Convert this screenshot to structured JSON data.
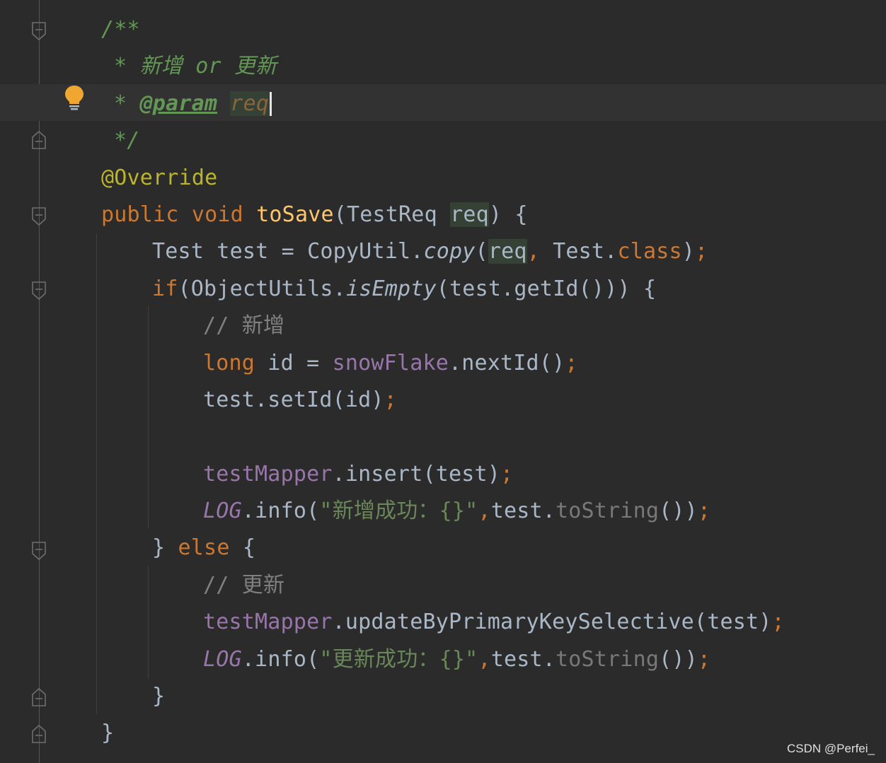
{
  "editor": {
    "lines": {
      "l1_doc_open": "/**",
      "l2_doc_star": "* ",
      "l2_doc_text": "新增 or 更新",
      "l3_doc_star": "* ",
      "l3_param_tag": "@param",
      "l3_param_name": "req",
      "l4_doc_close": "*/",
      "l5_annotation": "@Override",
      "l6_public": "public",
      "l6_void": "void",
      "l6_method": "toSave",
      "l6_paren_open": "(TestReq ",
      "l6_param": "req",
      "l6_tail": ") {",
      "l7_decl": "Test test = CopyUtil.",
      "l7_copy": "copy",
      "l7_paren": "(",
      "l7_req": "req",
      "l7_comma": ", ",
      "l7_test": "Test.",
      "l7_class": "class",
      "l7_close": ")",
      "l7_semi": ";",
      "l8_if": "if",
      "l8_obj": "(ObjectUtils.",
      "l8_isEmpty": "isEmpty",
      "l8_tail": "(test.getId())) {",
      "l9_comment": "// 新增",
      "l10_long": "long",
      "l10_mid": " id = ",
      "l10_snow": "snowFlake",
      "l10_next": ".nextId()",
      "l10_semi": ";",
      "l11_set": "test.setId(id)",
      "l11_semi": ";",
      "l13_mapper": "testMapper",
      "l13_insert": ".insert(test)",
      "l13_semi": ";",
      "l14_log": "LOG",
      "l14_info": ".info(",
      "l14_str": "\"新增成功：{}\"",
      "l14_comma": ",",
      "l14_test": "test.",
      "l14_tostr": "toString",
      "l14_close": "())",
      "l14_semi": ";",
      "l15_close": "} ",
      "l15_else": "else",
      "l15_brace": " {",
      "l16_comment": "// 更新",
      "l17_mapper": "testMapper",
      "l17_update": ".updateByPrimaryKeySelective(test)",
      "l17_semi": ";",
      "l18_log": "LOG",
      "l18_info": ".info(",
      "l18_str": "\"更新成功：{}\"",
      "l18_comma": ",",
      "l18_test": "test.",
      "l18_tostr": "toString",
      "l18_close": "())",
      "l18_semi": ";",
      "l19_brace": "}",
      "l20_brace": "}"
    },
    "colors": {
      "background": "#2b2b2b",
      "current_line": "#323232",
      "keyword": "#cc7832",
      "doc_comment": "#629755",
      "annotation": "#bbb529",
      "method_decl": "#ffc66d",
      "field": "#9876aa",
      "string": "#6a8759",
      "text": "#a9b7c6",
      "bulb": "#f0a732"
    },
    "icons": [
      "fold-icon",
      "intention-bulb-icon"
    ]
  },
  "watermark": "CSDN @Perfei_"
}
